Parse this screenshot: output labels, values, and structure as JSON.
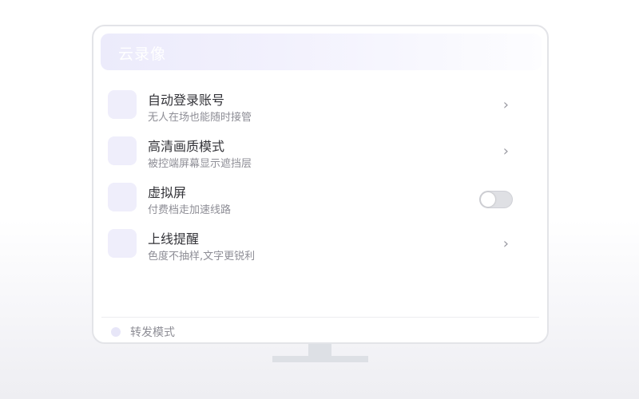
{
  "app": {
    "title": "云录像"
  },
  "settings": [
    {
      "title": "自动登录账号",
      "subtitle": "无人在场也能随时接管",
      "control": "chevron"
    },
    {
      "title": "高清画质模式",
      "subtitle": "被控端屏幕显示遮挡层",
      "control": "chevron"
    },
    {
      "title": "虚拟屏",
      "subtitle": "付费档走加速线路",
      "control": "toggle",
      "toggle_on": false
    },
    {
      "title": "上线提醒",
      "subtitle": "色度不抽样,文字更锐利",
      "control": "chevron"
    }
  ],
  "chevron_glyph": "›",
  "footer": {
    "label": "转发模式"
  },
  "colors": {
    "accent_light": "#efeefb",
    "title_bar": "#ecebfb",
    "toggle_off": "#dfe0e4"
  }
}
